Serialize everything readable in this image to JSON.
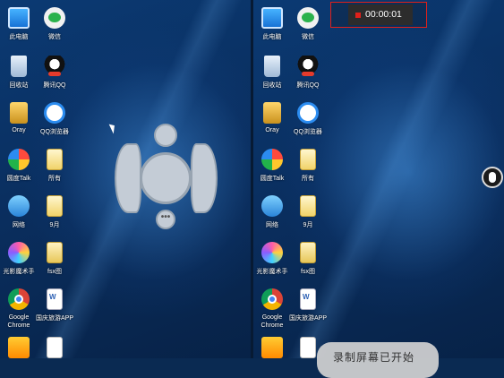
{
  "desktop_icons": [
    {
      "label": "此电脑",
      "icon": "this-pc-icon"
    },
    {
      "label": "微信",
      "icon": "wechat-icon"
    },
    {
      "label": "回收站",
      "icon": "recycle-bin-icon"
    },
    {
      "label": "腾讯QQ",
      "icon": "qq-icon"
    },
    {
      "label": "Oray",
      "icon": "oray-icon"
    },
    {
      "label": "QQ浏览器",
      "icon": "qq-browser-icon"
    },
    {
      "label": "圆度Talk",
      "icon": "talk-icon"
    },
    {
      "label": "所有",
      "icon": "folder-icon"
    },
    {
      "label": "网络",
      "icon": "network-icon"
    },
    {
      "label": "9月",
      "icon": "folder-icon"
    },
    {
      "label": "光影魔术手",
      "icon": "photo-editor-icon"
    },
    {
      "label": "fsx图",
      "icon": "archive-icon"
    },
    {
      "label": "Google\nChrome",
      "icon": "chrome-icon"
    },
    {
      "label": "国庆旅游APP",
      "icon": "document-icon"
    },
    {
      "label": "",
      "icon": "media-player-icon"
    },
    {
      "label": "",
      "icon": "blank-file-icon"
    }
  ],
  "recording": {
    "timer": "00:00:01",
    "toast": "录制屏幕已开始"
  },
  "float_control": {
    "more_label": "•••"
  }
}
